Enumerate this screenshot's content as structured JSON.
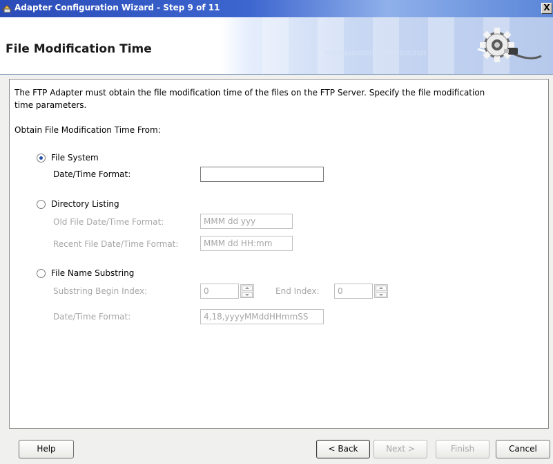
{
  "window": {
    "title": "Adapter Configuration Wizard - Step 9 of 11",
    "close_label": "X"
  },
  "header": {
    "page_title": "File Modification Time",
    "binary_decoration": "010101010101010101010101010101"
  },
  "content": {
    "description": [
      "The FTP Adapter must obtain the file modification time of the files on the FTP Server.  Specify the file modification",
      "time parameters."
    ],
    "obtain_label": "Obtain File Modification Time From:",
    "file_system": {
      "label": "File System",
      "checked": true,
      "date_time_format_label": "Date/Time Format:",
      "date_time_format_value": ""
    },
    "directory_listing": {
      "label": "Directory Listing",
      "checked": false,
      "old_format_label": "Old File Date/Time Format:",
      "old_format_value": "MMM dd yyy",
      "recent_format_label": "Recent File Date/Time Format:",
      "recent_format_value": "MMM dd HH:mm"
    },
    "file_name_substring": {
      "label": "File Name Substring",
      "checked": false,
      "begin_index_label": "Substring Begin Index:",
      "begin_index_value": "0",
      "end_index_label": "End Index:",
      "end_index_value": "0",
      "date_time_format_label": "Date/Time Format:",
      "date_time_format_value": "4,18,yyyyMMddHHmmSS"
    }
  },
  "footer": {
    "help": "Help",
    "back": "< Back",
    "next": "Next >",
    "finish": "Finish",
    "cancel": "Cancel"
  },
  "colors": {
    "titlebar": "#2a4bb8",
    "radio_selected": "#274fa9",
    "disabled_text": "#a6a6a6"
  },
  "icons": [
    "app-icon",
    "close-icon",
    "gear-plug-icon",
    "spinner-icon"
  ]
}
